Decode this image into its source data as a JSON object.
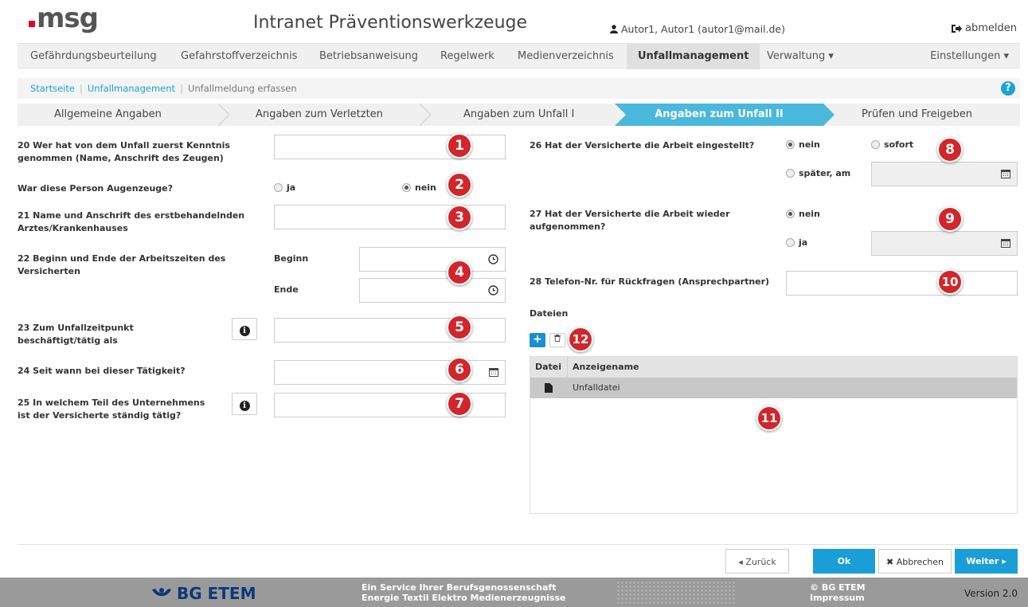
{
  "header": {
    "logo": ".msg",
    "title": "Intranet Präventionswerkzeuge",
    "user": "Autor1, Autor1 (autor1@mail.de)",
    "logout": "abmelden"
  },
  "nav": {
    "items": [
      "Gefährdungsbeurteilung",
      "Gefahrstoffverzeichnis",
      "Betriebsanweisung",
      "Regelwerk",
      "Medienverzeichnis",
      "Unfallmanagement",
      "Verwaltung ▾"
    ],
    "active": "Unfallmanagement",
    "settings": "Einstellungen ▾"
  },
  "breadcrumb": {
    "items": [
      "Startseite",
      "Unfallmanagement",
      "Unfallmeldung erfassen"
    ],
    "help": "?"
  },
  "steps": [
    "Allgemeine Angaben",
    "Angaben zum Verletzten",
    "Angaben zum Unfall I",
    "Angaben zum Unfall II",
    "Prüfen und Freigeben"
  ],
  "active_step": "Angaben zum Unfall II",
  "form": {
    "q20": "20 Wer hat von dem Unfall zuerst Kenntnis genommen (Name, Anschrift des Zeugen)",
    "q20b": "War diese Person Augenzeuge?",
    "q20b_opt_ja": "ja",
    "q20b_opt_nein": "nein",
    "q20b_selected": "nein",
    "q21": "21 Name und Anschrift des erstbehandelnden Arztes/Krankenhauses",
    "q22": "22 Beginn und Ende der Arbeitszeiten des Versicherten",
    "q22_beginn": "Beginn",
    "q22_ende": "Ende",
    "q23": "23 Zum Unfallzeitpunkt beschäftigt/tätig als",
    "q24": "24 Seit wann bei dieser Tätigkeit?",
    "q25": "25 In welchem Teil des Unternehmens ist der Versicherte ständig tätig?",
    "q26": "26 Hat der Versicherte die Arbeit eingestellt?",
    "q26_opt_nein": "nein",
    "q26_opt_sofort": "sofort",
    "q26_opt_spaeter": "später, am",
    "q26_selected": "nein",
    "q27": "27 Hat der Versicherte die Arbeit wieder aufgenommen?",
    "q27_opt_nein": "nein",
    "q27_opt_ja": "ja",
    "q27_selected": "nein",
    "q28": "28 Telefon-Nr. für Rückfragen (Ansprechpartner)",
    "files_label": "Dateien"
  },
  "files": {
    "col_datei": "Datei",
    "col_anzeigename": "Anzeigename",
    "rows": [
      {
        "name": "Unfalldatei"
      }
    ]
  },
  "badges": [
    "1",
    "2",
    "3",
    "4",
    "5",
    "6",
    "7",
    "8",
    "9",
    "10",
    "11",
    "12"
  ],
  "buttons": {
    "back": "◂ Zurück",
    "ok": "Ok",
    "cancel": "✖ Abbrechen",
    "next": "Weiter ▸"
  },
  "footer": {
    "brand": "BG ETEM",
    "service_line1": "Ein Service Ihrer Berufsgenossenschaft",
    "service_line2": "Energie Textil Elektro Medienerzeugnisse",
    "copyright": "© BG ETEM",
    "impressum": "Impressum",
    "version": "Version 2.0"
  },
  "colors": {
    "accent": "#1a9ed8",
    "step_active": "#4ab8dc",
    "badge": "#d1262b",
    "logo": "#e3002b"
  }
}
